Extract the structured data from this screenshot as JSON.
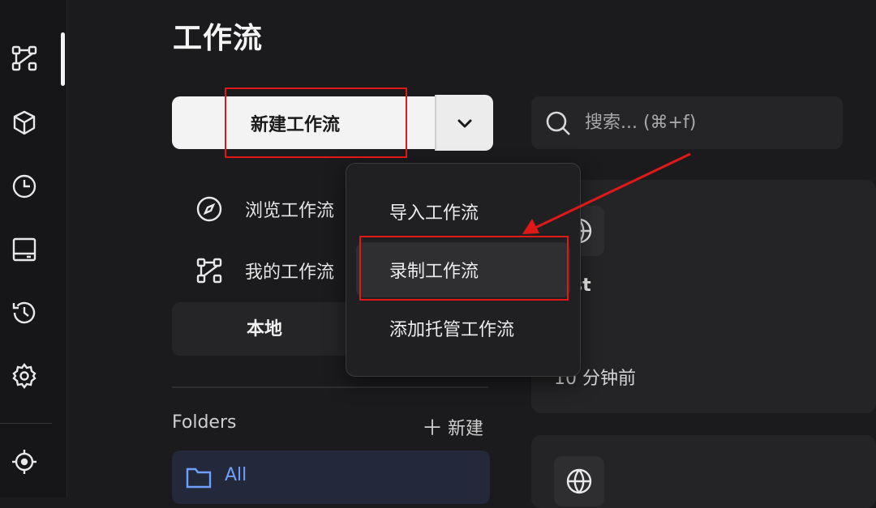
{
  "page": {
    "title": "工作流"
  },
  "rail": {
    "items": [
      {
        "icon": "workflow-icon",
        "active": true
      },
      {
        "icon": "cube-icon"
      },
      {
        "icon": "clock-icon"
      },
      {
        "icon": "panel-icon"
      },
      {
        "icon": "history-icon"
      },
      {
        "icon": "gear-icon"
      },
      {
        "icon": "crosshair-icon"
      }
    ]
  },
  "toolbar": {
    "new_label": "新建工作流"
  },
  "nav": {
    "items": [
      {
        "label": "浏览工作流",
        "icon": "compass-icon"
      },
      {
        "label": "我的工作流",
        "icon": "workflow-icon"
      }
    ]
  },
  "tabs": {
    "local_label": "本地"
  },
  "folders": {
    "title": "Folders",
    "new_label": "新建",
    "all_label": "All"
  },
  "search": {
    "placeholder": "搜索... (⌘+f)"
  },
  "cards": [
    {
      "title_fragment": "st",
      "time_fragment": "10 分钟前",
      "icon": "globe-icon"
    },
    {
      "icon": "globe-icon"
    }
  ],
  "dropdown_menu": {
    "items": [
      {
        "label": "导入工作流"
      },
      {
        "label": "录制工作流",
        "hovered": true
      },
      {
        "label": "添加托管工作流"
      }
    ]
  },
  "annotations": {
    "color": "#e01818"
  },
  "colors": {
    "background": "#1b1b1d",
    "accent": "#6ea0ff",
    "button": "#f3f3f3"
  }
}
